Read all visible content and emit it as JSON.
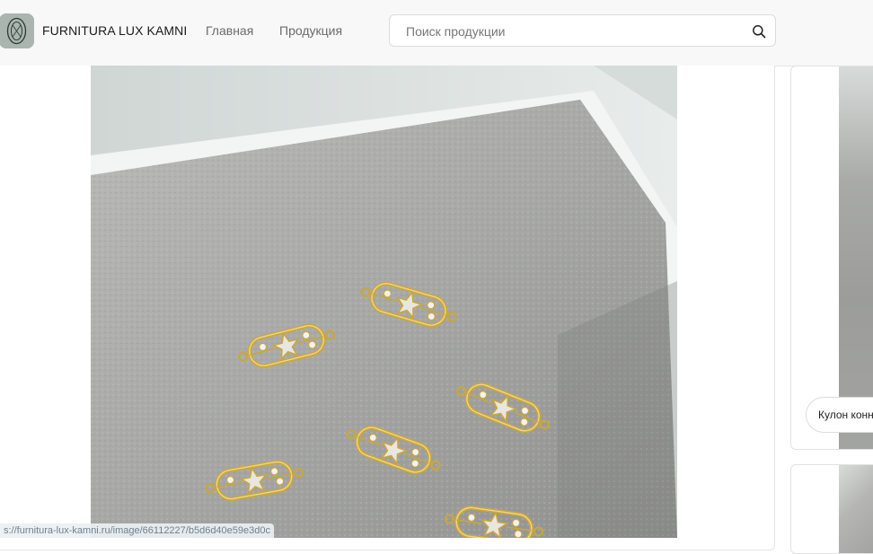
{
  "header": {
    "brand": "FURNITURA LUX KAMNI",
    "nav": [
      {
        "label": "Главная"
      },
      {
        "label": "Продукция"
      }
    ],
    "search": {
      "placeholder": "Поиск продукции"
    }
  },
  "side_products": [
    {
      "caption": "Кулон конн"
    }
  ],
  "status_bar": {
    "url": "s://furnitura-lux-kamni.ru/image/66112227/b5d6d40e59e3d0c"
  },
  "colors": {
    "accent": "#c9a640",
    "header_bg": "#f8f8f8",
    "felt": "#a9a9a7"
  }
}
